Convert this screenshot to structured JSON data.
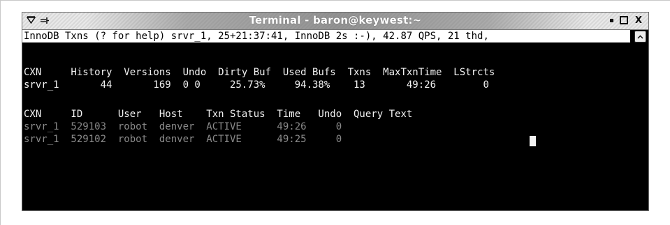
{
  "window": {
    "title": "Terminal - baron@keywest:~",
    "icons": [
      "menu-triangle-icon",
      "sticky-pin-icon",
      "minimize-icon",
      "maximize-icon",
      "close-icon"
    ],
    "close_glyph": "X"
  },
  "terminal": {
    "status_line": "InnoDB Txns (? for help) srvr_1, 25+21:37:41, InnoDB 2s :-), 42.87 QPS, 21 thd,",
    "table1_header": "CXN     History  Versions  Undo  Dirty Buf  Used Bufs  Txns  MaxTxnTime  LStrcts",
    "table1_rows": [
      "srvr_1       44       169  0 0     25.73%     94.38%    13       49:26        0"
    ],
    "table2_header": "CXN     ID      User   Host    Txn Status  Time   Undo  Query Text",
    "table2_rows": [
      "srvr_1  529103  robot  denver  ACTIVE      49:26     0",
      "srvr_1  529102  robot  denver  ACTIVE      49:25     0"
    ]
  },
  "colors": {
    "terminal_bg": "#000000",
    "text_bright": "#f2f2f2",
    "text_dim": "#8a8a8a",
    "status_bg": "#ffffff"
  }
}
